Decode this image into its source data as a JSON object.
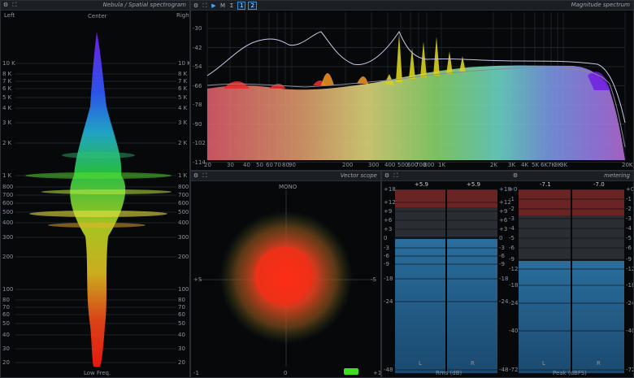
{
  "spectrogram": {
    "title": "Nebula / Spatial spectrogram",
    "left_label": "Left",
    "center_label": "Center",
    "right_label": "Right",
    "bottom_label": "Low Freq.",
    "freq_ticks": [
      "10 K",
      "8 K",
      "7 K",
      "6 K",
      "5 K",
      "4 K",
      "3 K",
      "2 K",
      "1 K",
      "800",
      "700",
      "600",
      "500",
      "400",
      "300",
      "200",
      "100",
      "80",
      "70",
      "60",
      "50",
      "40",
      "30",
      "20"
    ]
  },
  "spectrum": {
    "title": "Magnitude spectrum",
    "toolbar": {
      "m_label": "M",
      "sigma_label": "Σ",
      "ch1_label": "1",
      "ch2_label": "2"
    },
    "y_ticks": [
      "-30",
      "-42",
      "-54",
      "-66",
      "-78",
      "-90",
      "-102",
      "-114"
    ],
    "x_ticks": [
      "20",
      "30",
      "40",
      "50",
      "60",
      "70",
      "80",
      "90",
      "200",
      "300",
      "400",
      "500",
      "600",
      "700",
      "800",
      "1K",
      "2K",
      "3K",
      "4K",
      "5K",
      "6K",
      "7K",
      "8K",
      "9K",
      "20K"
    ]
  },
  "vectorscope": {
    "title": "Vector scope",
    "top_label": "MONO",
    "left_label": "+S",
    "right_label": "-S",
    "bottom_left": "-1",
    "bottom_center": "0",
    "bottom_right": "+1"
  },
  "metering": {
    "title": "metering",
    "rms": {
      "label": "Rms (dB)",
      "left_value": "+5.9",
      "right_value": "+5.9",
      "ch_left": "L",
      "ch_right": "R",
      "scale": [
        "+18",
        "+12",
        "+9",
        "+6",
        "+3",
        "0",
        "-3",
        "-6",
        "-9",
        "-18",
        "-24",
        "-48"
      ],
      "scale_right": [
        "+18",
        "+12",
        "+9",
        "+6",
        "+3",
        "0",
        "-3",
        "-6",
        "-9",
        "-18",
        "-24",
        "-48"
      ]
    },
    "peak": {
      "label": "Peak (dBFS)",
      "left_value": "-7.1",
      "right_value": "-7.0",
      "ch_left": "L",
      "ch_right": "R",
      "scale": [
        "+0",
        "-1",
        "-2",
        "-3",
        "-4",
        "-5",
        "-6",
        "-9",
        "-12",
        "-18",
        "-24",
        "-40",
        "-72"
      ],
      "scale_right": [
        "+0",
        "-1",
        "-2",
        "-3",
        "-4",
        "-5",
        "-6",
        "-9",
        "-12",
        "-18",
        "-24",
        "-40",
        "-72"
      ]
    }
  }
}
